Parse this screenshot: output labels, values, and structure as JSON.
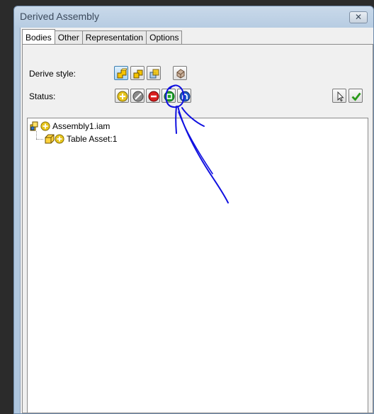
{
  "window": {
    "title": "Derived Assembly",
    "close_glyph": "✕"
  },
  "tabs": [
    {
      "label": "Bodies",
      "active": true
    },
    {
      "label": "Other",
      "active": false
    },
    {
      "label": "Representation",
      "active": false
    },
    {
      "label": "Options",
      "active": false
    }
  ],
  "derive_style": {
    "label": "Derive style:",
    "buttons": [
      {
        "icon": "single-solid-merged-icon",
        "selected": true
      },
      {
        "icon": "single-solid-seams-icon",
        "selected": false
      },
      {
        "icon": "multi-solid-icon",
        "selected": false
      },
      {
        "icon": "surface-body-icon",
        "selected": false
      }
    ]
  },
  "status": {
    "label": "Status:",
    "buttons": [
      {
        "icon": "include-icon",
        "color": "#e7c51e"
      },
      {
        "icon": "exclude-icon",
        "color": "#8c8c8c"
      },
      {
        "icon": "subtract-icon",
        "color": "#d81d1d"
      },
      {
        "icon": "bounding-box-icon",
        "color": "#1fa32c"
      },
      {
        "icon": "intersect-icon",
        "color": "#1d5bc6"
      }
    ]
  },
  "tree": {
    "nodes": [
      {
        "label": "Assembly1.iam",
        "level": 0
      },
      {
        "label": "Table Asset:1",
        "level": 1
      }
    ]
  },
  "colors": {
    "annotation": "#1010e0",
    "ok_check": "#2a9a1a"
  }
}
